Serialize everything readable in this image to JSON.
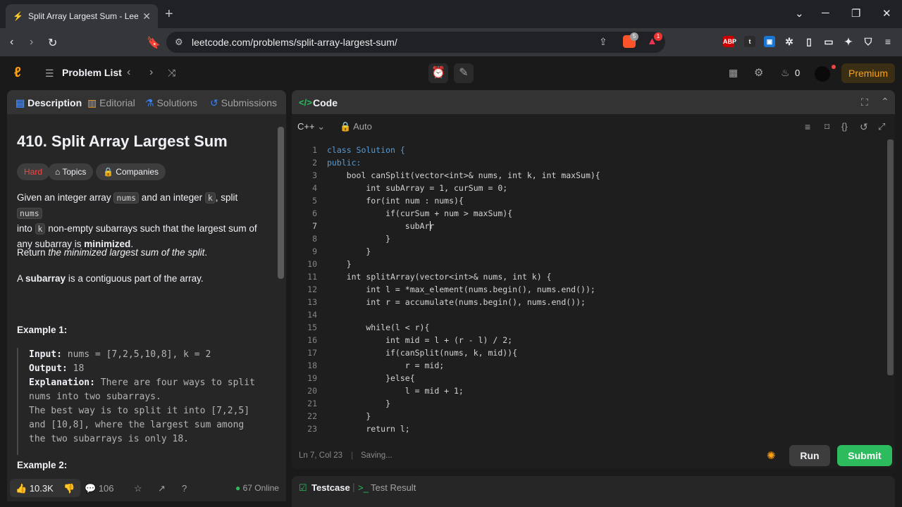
{
  "browser": {
    "tab_title": "Split Array Largest Sum - LeetC",
    "url": "leetcode.com/problems/split-array-largest-sum/",
    "new_tab": "+",
    "badge_brave": "5",
    "badge_alert": "1"
  },
  "header": {
    "problem_list": "Problem List",
    "streak": "0",
    "premium": "Premium"
  },
  "left": {
    "tabs": [
      "Description",
      "Editorial",
      "Solutions",
      "Submissions"
    ],
    "title": "410. Split Array Largest Sum",
    "difficulty": "Hard",
    "topics": "Topics",
    "companies": "Companies",
    "p1": {
      "a": "Given an integer array ",
      "nums": "nums",
      "b": " and an integer ",
      "k": "k",
      "c": ", split ",
      "nums2": "nums",
      "d": "into ",
      "k2": "k",
      "e": " non-empty subarrays such that the largest sum of any subarray is ",
      "f": "minimized",
      "g": "."
    },
    "p2": {
      "a": "Return ",
      "b": "the minimized largest sum of the split",
      "c": "."
    },
    "p3": {
      "a": "A ",
      "b": "subarray",
      "c": " is a contiguous part of the array."
    },
    "example1_title": "Example 1:",
    "example1": {
      "input_label": "Input:",
      "input": " nums = [7,2,5,10,8], k = 2",
      "output_label": "Output:",
      "output": " 18",
      "expl_label": "Explanation:",
      "expl1": " There are four ways to split",
      "expl2": "nums into two subarrays.",
      "expl3": "The best way is to split it into [7,2,5]",
      "expl4": "and [10,8], where the largest sum among",
      "expl5": "the two subarrays is only 18."
    },
    "example2_title": "Example 2:",
    "likes": "10.3K",
    "comments": "106",
    "online": "67 Online"
  },
  "right": {
    "code_title": "Code",
    "language": "C++",
    "mode": "Auto",
    "status_position": "Ln 7, Col 23",
    "status_saving": "Saving...",
    "run": "Run",
    "submit": "Submit",
    "testcase": "Testcase",
    "test_result": "Test Result",
    "line_numbers": [
      "1",
      "2",
      "3",
      "4",
      "5",
      "6",
      "7",
      "8",
      "9",
      "10",
      "11",
      "12",
      "13",
      "14",
      "15",
      "16",
      "17",
      "18",
      "19",
      "20",
      "21",
      "22",
      "23"
    ],
    "code_lines": [
      "class Solution {",
      "public:",
      "    bool canSplit(vector<int>& nums, int k, int maxSum){",
      "        int subArray = 1, curSum = 0;",
      "        for(int num : nums){",
      "            if(curSum + num > maxSum){",
      "                subArr",
      "            }",
      "        }",
      "    }",
      "    int splitArray(vector<int>& nums, int k) {",
      "        int l = *max_element(nums.begin(), nums.end());",
      "        int r = accumulate(nums.begin(), nums.end());",
      "",
      "        while(l < r){",
      "            int mid = l + (r - l) / 2;",
      "            if(canSplit(nums, k, mid)){",
      "                r = mid;",
      "            }else{",
      "                l = mid + 1;",
      "            }",
      "        }",
      "        return l;"
    ]
  },
  "colors": {
    "accent_orange": "#ffa116",
    "submit_green": "#2cbb5d",
    "hard_red": "#ef4743"
  }
}
